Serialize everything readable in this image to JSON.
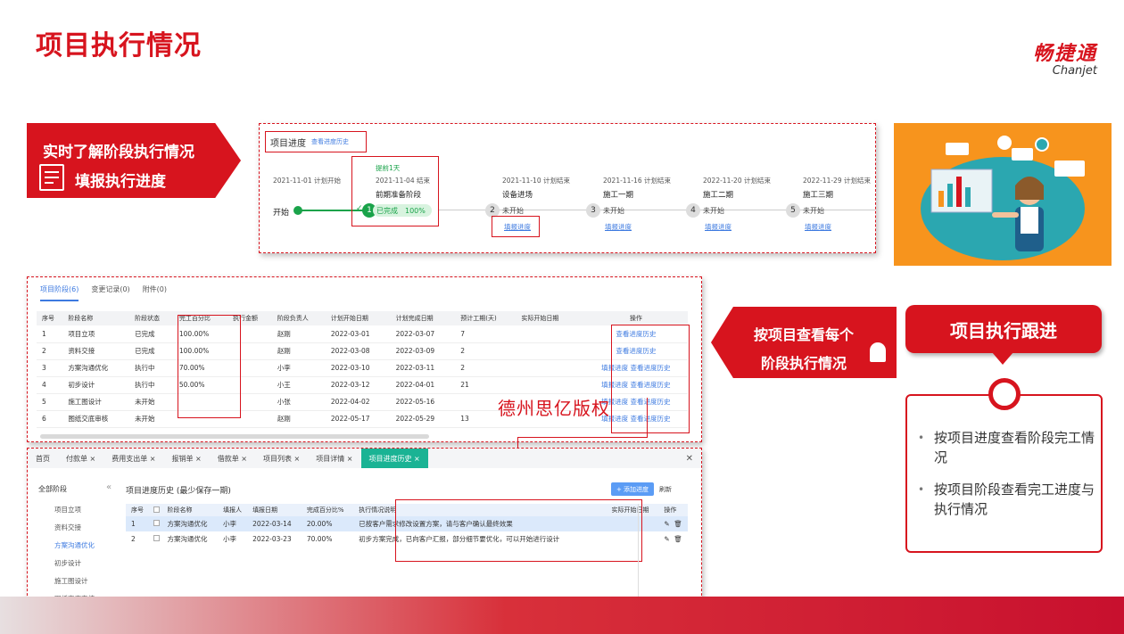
{
  "title": "项目执行情况",
  "logo": {
    "cn": "畅捷通",
    "en": "Chanjet"
  },
  "callout_left": {
    "line1": "实时了解阶段执行情况",
    "line2": "填报执行进度"
  },
  "progress": {
    "header": "项目进度",
    "history_link": "查看进度历史",
    "start_date": "2021-11-01 计划开始",
    "start_label": "开始",
    "early_text": "提前1天",
    "done_text": "已完成",
    "done_pct": "100%",
    "stages": [
      {
        "date": "2021-11-04 结束",
        "name": "前期准备阶段",
        "num": "1",
        "status": ""
      },
      {
        "date": "2021-11-10 计划结束",
        "name": "设备进场",
        "num": "2",
        "status": "未开始",
        "link": "填报进度"
      },
      {
        "date": "2021-11-16 计划结束",
        "name": "施工一期",
        "num": "3",
        "status": "未开始",
        "link": "填报进度"
      },
      {
        "date": "2022-11-20 计划结束",
        "name": "施工二期",
        "num": "4",
        "status": "未开始",
        "link": "填报进度"
      },
      {
        "date": "2022-11-29 计划结束",
        "name": "施工三期",
        "num": "5",
        "status": "未开始",
        "link": "填报进度"
      }
    ]
  },
  "stage_table": {
    "tabs": [
      "项目阶段(6)",
      "变更记录(0)",
      "附件(0)"
    ],
    "columns": [
      "序号",
      "阶段名称",
      "阶段状态",
      "完工百分比",
      "执行金额",
      "阶段负责人",
      "计划开始日期",
      "计划完成日期",
      "预计工期(天)",
      "实际开始日期",
      "操作"
    ],
    "rows": [
      [
        "1",
        "项目立项",
        "已完成",
        "100.00%",
        "",
        "赵刚",
        "2022-03-01",
        "2022-03-07",
        "7",
        "",
        "查看进度历史"
      ],
      [
        "2",
        "资料交接",
        "已完成",
        "100.00%",
        "",
        "赵刚",
        "2022-03-08",
        "2022-03-09",
        "2",
        "",
        "查看进度历史"
      ],
      [
        "3",
        "方案沟通优化",
        "执行中",
        "70.00%",
        "",
        "小李",
        "2022-03-10",
        "2022-03-11",
        "2",
        "",
        "填报进度  查看进度历史"
      ],
      [
        "4",
        "初步设计",
        "执行中",
        "50.00%",
        "",
        "小王",
        "2022-03-12",
        "2022-04-01",
        "21",
        "",
        "填报进度  查看进度历史"
      ],
      [
        "5",
        "施工图设计",
        "未开始",
        "",
        "",
        "小张",
        "2022-04-02",
        "2022-05-16",
        "",
        "",
        "填报进度  查看进度历史"
      ],
      [
        "6",
        "图纸交底审核",
        "未开始",
        "",
        "",
        "赵刚",
        "2022-05-17",
        "2022-05-29",
        "13",
        "",
        "填报进度  查看进度历史"
      ]
    ]
  },
  "watermark": "德州思亿版权",
  "callout_mid": {
    "line1": "按项目查看每个",
    "line2": "阶段执行情况"
  },
  "follow": {
    "title": "项目执行跟进",
    "items": [
      "按项目进度查看阶段完工情况",
      "按项目阶段查看完工进度与执行情况"
    ]
  },
  "history": {
    "tabs": [
      "首页",
      "付款单 ×",
      "费用支出单 ×",
      "报销单 ×",
      "借款单 ×",
      "项目列表 ×",
      "项目详情 ×",
      "项目进度历史 ×"
    ],
    "active_tab": "项目进度历史 ×",
    "nav_head": "全部阶段",
    "nav_items": [
      "项目立项",
      "资料交接",
      "方案沟通优化",
      "初步设计",
      "施工图设计",
      "图纸交底审核"
    ],
    "title": "项目进度历史 (最少保存一期)",
    "add_btn": "+ 添加进度",
    "refresh": "刷新",
    "columns": [
      "序号",
      "",
      "阶段名称",
      "填报人",
      "填报日期",
      "完成百分比%",
      "执行情况说明",
      "实际开始日期",
      "操作"
    ],
    "rows": [
      [
        "1",
        "",
        "方案沟通优化",
        "小李",
        "2022-03-14",
        "20.00%",
        "已按客户需求修改设置方案，请与客户确认最终效果",
        "",
        ""
      ],
      [
        "2",
        "",
        "方案沟通优化",
        "小李",
        "2022-03-23",
        "70.00%",
        "初步方案完成，已向客户汇报，部分细节要优化，可以开始进行设计",
        "",
        ""
      ]
    ]
  },
  "colors": {
    "brand": "#d7141e",
    "link": "#3d7ae0",
    "success": "#1aa34a"
  }
}
